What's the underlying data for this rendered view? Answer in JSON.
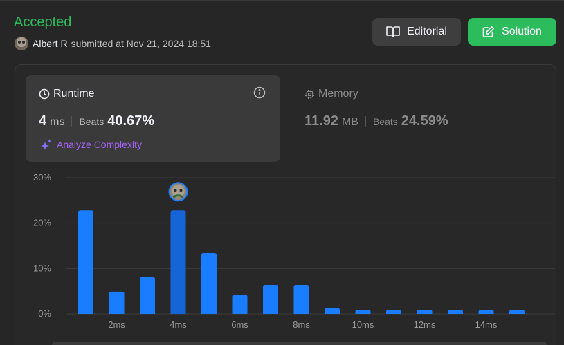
{
  "status": {
    "text": "Accepted",
    "color": "#2cbb5d"
  },
  "submission": {
    "user": "Albert R",
    "submitted_text": "submitted at Nov 21, 2024 18:51"
  },
  "buttons": {
    "editorial": "Editorial",
    "solution": "Solution"
  },
  "runtime": {
    "title": "Runtime",
    "value": "4",
    "unit": "ms",
    "beats_label": "Beats",
    "beats_value": "40.67%",
    "analyze_label": "Analyze Complexity"
  },
  "memory": {
    "title": "Memory",
    "value": "11.92",
    "unit": "MB",
    "beats_label": "Beats",
    "beats_value": "24.59%"
  },
  "chart_data": {
    "type": "bar",
    "x": [
      1,
      2,
      3,
      4,
      5,
      6,
      7,
      8,
      9,
      10,
      11,
      12,
      13,
      14,
      15
    ],
    "values": [
      22.8,
      4.9,
      8.1,
      22.8,
      13.4,
      4.2,
      6.4,
      6.4,
      1.3,
      0.9,
      0.9,
      0.9,
      0.9,
      0.9,
      0.9
    ],
    "highlight_x": 4,
    "xticks": [
      "2ms",
      "4ms",
      "6ms",
      "8ms",
      "10ms",
      "12ms",
      "14ms"
    ],
    "xtick_values": [
      2,
      4,
      6,
      8,
      10,
      12,
      14
    ],
    "yticks": [
      "0%",
      "10%",
      "20%",
      "30%"
    ],
    "ytick_values": [
      0,
      10,
      20,
      30
    ],
    "ylim": [
      0,
      30
    ],
    "grid": true,
    "colors": {
      "bar": "#1a7cff",
      "highlight": "#1565d8",
      "grid": "#3d3d3d"
    }
  }
}
